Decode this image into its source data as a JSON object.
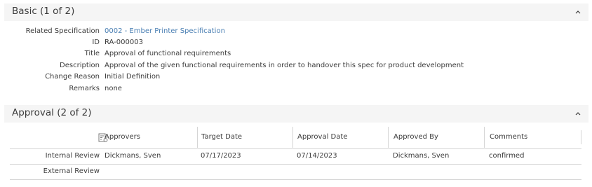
{
  "basic": {
    "title": "Basic (1 of 2)",
    "fields": [
      {
        "label": "Related Specification",
        "value": "0002 - Ember Printer Specification"
      },
      {
        "label": "ID",
        "value": "RA-000003"
      },
      {
        "label": "Title",
        "value": "Approval of functional requirements"
      },
      {
        "label": "Description",
        "value": "Approval of the given functional requirements in order to handover this spec for product development"
      },
      {
        "label": "Change Reason",
        "value": "Initial Definition"
      },
      {
        "label": "Remarks",
        "value": "none"
      }
    ]
  },
  "approval": {
    "title": "Approval (2 of 2)",
    "columns": [
      "Approvers",
      "Target Date",
      "Approval Date",
      "Approved By",
      "Comments"
    ],
    "rows": [
      {
        "label": "Internal Review",
        "approvers": "Dickmans, Sven",
        "target_date": "07/17/2023",
        "approval_date": "07/14/2023",
        "approved_by": "Dickmans, Sven",
        "comments": "confirmed"
      },
      {
        "label": "External Review",
        "approvers": "",
        "target_date": "",
        "approval_date": "",
        "approved_by": "",
        "comments": ""
      }
    ]
  },
  "icons": {
    "collapse": "chevron-up-icon",
    "table_settings": "table-settings-icon"
  },
  "colors": {
    "header_bg": "#f5f5f5",
    "link": "#4a7fb3",
    "text": "#3c3c3c",
    "divider": "#d4d4d4"
  }
}
